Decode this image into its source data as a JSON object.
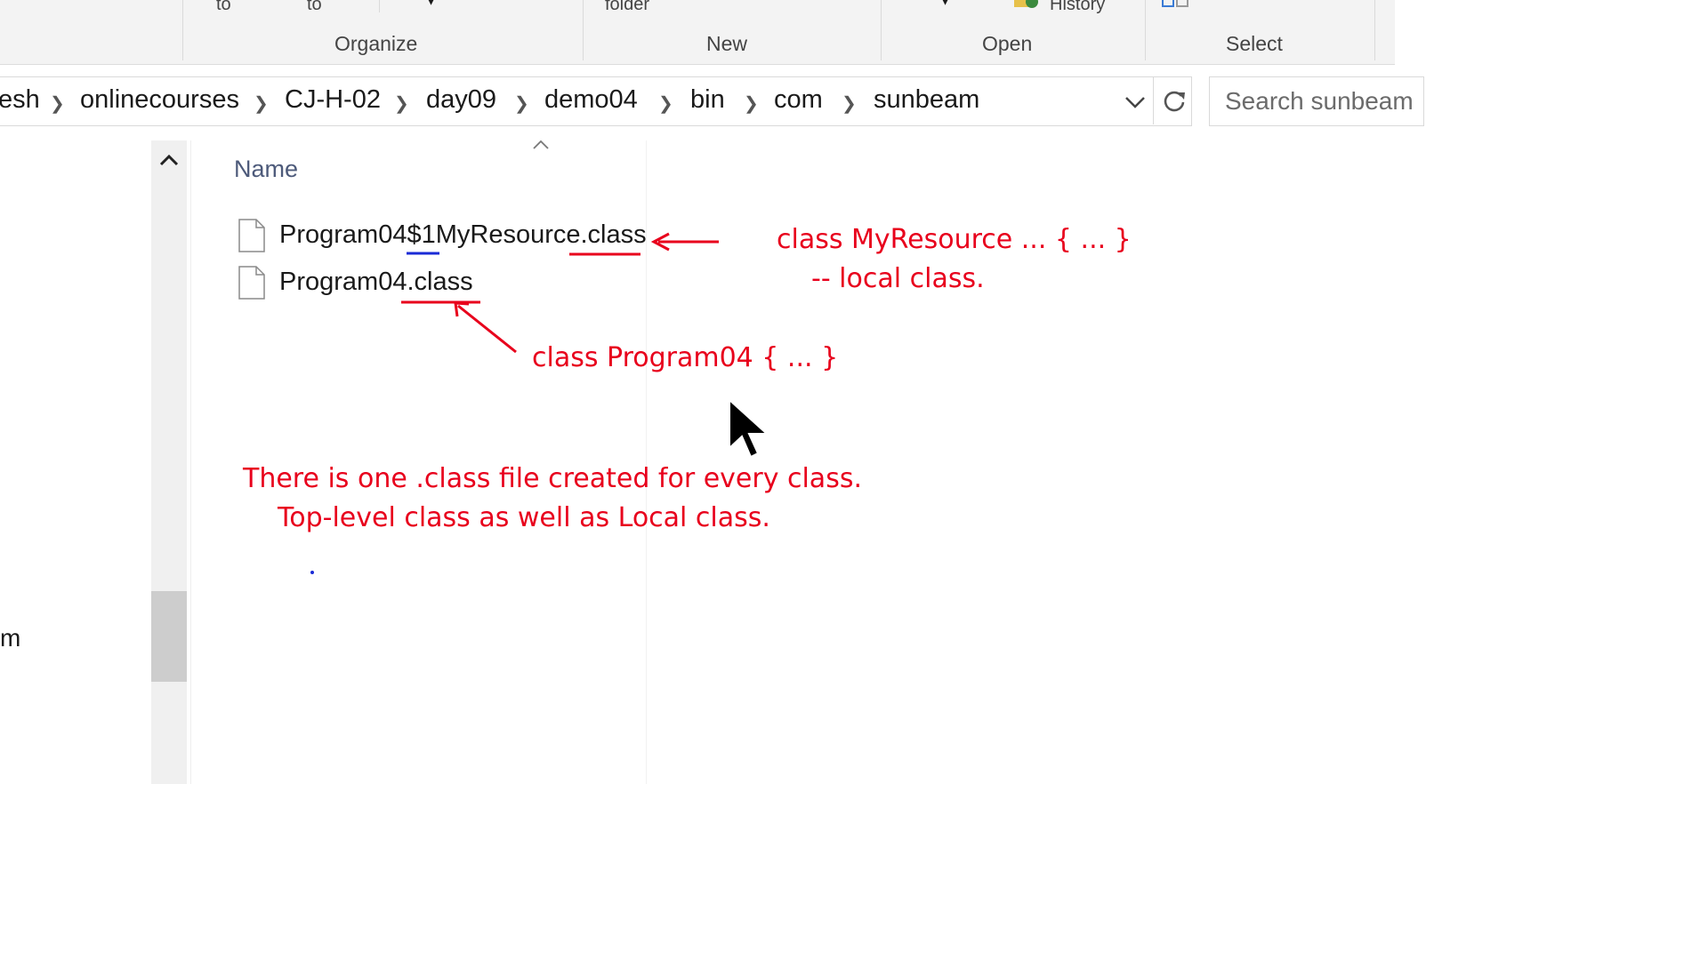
{
  "ribbon": {
    "cut_labels": [
      "to",
      "to",
      "folder",
      "History"
    ],
    "groups": [
      "Organize",
      "New",
      "Open",
      "Select"
    ]
  },
  "address": {
    "crumbs": [
      "esh",
      "onlinecourses",
      "CJ-H-02",
      "day09",
      "demo04",
      "bin",
      "com",
      "sunbeam"
    ]
  },
  "search": {
    "placeholder": "Search sunbeam"
  },
  "nav": {
    "partial_item": "m"
  },
  "columns": {
    "name": "Name"
  },
  "files": [
    {
      "name": "Program04$1MyResource.class"
    },
    {
      "name": "Program04.class"
    }
  ],
  "annotations": {
    "local_class_1": "class MyResource ... { ... }",
    "local_class_2": "-- local class.",
    "top_class": "class Program04 { ... }",
    "note_1": "There is one .class file created for every class.",
    "note_2": "Top-level class as well as Local class."
  },
  "colors": {
    "annotation": "#e8001c",
    "underline_blue": "#1a2bd6"
  }
}
